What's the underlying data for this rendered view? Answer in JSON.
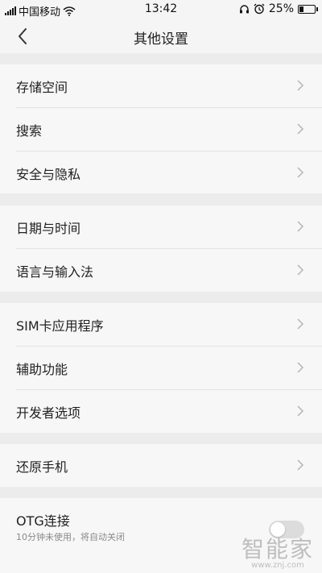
{
  "status_bar": {
    "carrier": "中国移动",
    "time": "13:42",
    "battery": "25%",
    "battery_level": 0.25
  },
  "header": {
    "title": "其他设置"
  },
  "groups": [
    {
      "items": [
        {
          "label": "存储空间"
        },
        {
          "label": "搜索"
        },
        {
          "label": "安全与隐私"
        }
      ]
    },
    {
      "items": [
        {
          "label": "日期与时间"
        },
        {
          "label": "语言与输入法"
        }
      ]
    },
    {
      "items": [
        {
          "label": "SIM卡应用程序"
        },
        {
          "label": "辅助功能"
        },
        {
          "label": "开发者选项"
        }
      ]
    },
    {
      "items": [
        {
          "label": "还原手机"
        }
      ]
    }
  ],
  "otg": {
    "label": "OTG连接",
    "subtitle": "10分钟未使用，将自动关闭",
    "enabled": false
  },
  "watermark": {
    "text": "智能家",
    "url": "www.znj.com"
  },
  "icons": {
    "back": "chevron-left-icon",
    "chevron": "chevron-right-icon",
    "wifi": "wifi-icon",
    "signal": "signal-icon",
    "alarm": "alarm-icon",
    "headset": "headset-icon",
    "battery": "battery-icon"
  },
  "colors": {
    "background": "#ececec",
    "card": "#f7f7f7",
    "text": "#222222",
    "chevron": "#b5b5b5",
    "subtext": "#8a8a8a"
  }
}
